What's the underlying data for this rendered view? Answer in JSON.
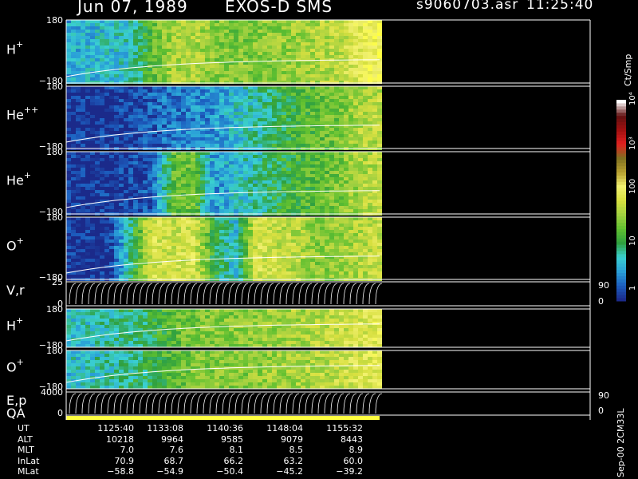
{
  "header": {
    "date": "Jun 07, 1989",
    "instrument": "EXOS-D SMS",
    "file": "s9060703.asr",
    "time": "11:25:40"
  },
  "panels": [
    {
      "id": "h1",
      "species": "H",
      "charge": "+",
      "ytop": "180",
      "ybot": "−180"
    },
    {
      "id": "he2",
      "species": "He",
      "charge": "++",
      "ytop": "180",
      "ybot": "−180"
    },
    {
      "id": "he1",
      "species": "He",
      "charge": "+",
      "ytop": "180",
      "ybot": "−180"
    },
    {
      "id": "o1",
      "species": "O",
      "charge": "+",
      "ytop": "180",
      "ybot": "−180"
    },
    {
      "id": "vr",
      "species": "V,r",
      "charge": "",
      "ytop": "25",
      "ybot": "0",
      "rtop": "90",
      "rbot": "0"
    },
    {
      "id": "h1b",
      "species": "H",
      "charge": "+",
      "ytop": "180",
      "ybot": "−180"
    },
    {
      "id": "o1b",
      "species": "O",
      "charge": "+",
      "ytop": "180",
      "ybot": "−180"
    },
    {
      "id": "ep",
      "species": "E,p",
      "charge": "",
      "ytop": "4000",
      "ybot": "0",
      "rtop": "90",
      "rbot": "0"
    }
  ],
  "qa_label": "QA",
  "colorbar": {
    "unit": "Ct/Smp",
    "ticks": [
      "10⁴",
      "10³",
      "100",
      "10",
      "1"
    ]
  },
  "footer_label": "Sep-00  2CM33L",
  "time_table": {
    "rows": [
      {
        "label": "UT",
        "values": [
          "1125:40",
          "1133:08",
          "1140:36",
          "1148:04",
          "1155:32"
        ]
      },
      {
        "label": "ALT",
        "values": [
          "10218",
          "9964",
          "9585",
          "9079",
          "8443"
        ]
      },
      {
        "label": "MLT",
        "values": [
          "7.0",
          "7.6",
          "8.1",
          "8.5",
          "8.9"
        ]
      },
      {
        "label": "InLat",
        "values": [
          "70.9",
          "68.7",
          "66.2",
          "63.2",
          "60.0"
        ]
      },
      {
        "label": "MLat",
        "values": [
          "−58.8",
          "−54.9",
          "−50.4",
          "−45.2",
          "−39.2"
        ]
      }
    ]
  },
  "chart_data": {
    "type": "heatmap",
    "title": "Jun 07, 1989   EXOS-D SMS",
    "x_ticks_ut": [
      "1125:40",
      "1133:08",
      "1140:36",
      "1148:04",
      "1155:32"
    ],
    "color_scale": {
      "unit": "Ct/Smp",
      "log": true,
      "range": [
        1,
        10000
      ]
    },
    "series": [
      {
        "name": "H+",
        "ylim": [
          -180,
          180
        ],
        "intensity_profile": [
          0.25,
          0.28,
          0.3,
          0.32,
          0.55,
          0.68,
          0.7,
          0.62,
          0.6,
          0.62,
          0.64,
          0.66,
          0.7,
          0.72,
          0.85,
          0.92
        ]
      },
      {
        "name": "He++",
        "ylim": [
          -180,
          180
        ],
        "intensity_profile": [
          0.02,
          0.02,
          0.03,
          0.05,
          0.1,
          0.15,
          0.18,
          0.2,
          0.3,
          0.35,
          0.45,
          0.5,
          0.55,
          0.6,
          0.7,
          0.72
        ]
      },
      {
        "name": "He+",
        "ylim": [
          -180,
          180
        ],
        "intensity_profile": [
          0.02,
          0.02,
          0.03,
          0.05,
          0.1,
          0.55,
          0.58,
          0.2,
          0.3,
          0.35,
          0.45,
          0.5,
          0.55,
          0.6,
          0.7,
          0.72
        ]
      },
      {
        "name": "O+",
        "ylim": [
          -180,
          180
        ],
        "intensity_profile": [
          0.02,
          0.02,
          0.03,
          0.4,
          0.8,
          0.75,
          0.8,
          0.45,
          0.3,
          0.8,
          0.75,
          0.7,
          0.62,
          0.65,
          0.7,
          0.75
        ]
      },
      {
        "name": "H+ (lower)",
        "ylim": [
          -180,
          180
        ],
        "intensity_profile": [
          0.3,
          0.32,
          0.35,
          0.4,
          0.45,
          0.55,
          0.6,
          0.62,
          0.62,
          0.64,
          0.66,
          0.68,
          0.7,
          0.75,
          0.8,
          0.85
        ]
      },
      {
        "name": "O+ (lower)",
        "ylim": [
          -180,
          180
        ],
        "intensity_profile": [
          0.3,
          0.32,
          0.35,
          0.4,
          0.45,
          0.55,
          0.6,
          0.62,
          0.62,
          0.64,
          0.66,
          0.68,
          0.7,
          0.75,
          0.8,
          0.85
        ]
      }
    ]
  }
}
